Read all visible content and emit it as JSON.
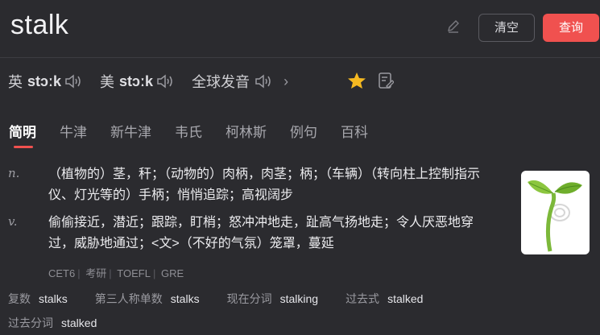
{
  "query": {
    "word": "stalk",
    "clear_label": "清空",
    "search_label": "查询"
  },
  "pronunciation": [
    {
      "lang": "英",
      "ipa": "stɔːk"
    },
    {
      "lang": "美",
      "ipa": "stɔːk"
    },
    {
      "lang": "全球发音",
      "ipa": ""
    }
  ],
  "tabs": [
    "简明",
    "牛津",
    "新牛津",
    "韦氏",
    "柯林斯",
    "例句",
    "百科"
  ],
  "definitions": [
    {
      "pos": "n.",
      "text": "（植物的）茎，秆；（动物的）肉柄，肉茎；柄；（车辆）（转向柱上控制指示仪、灯光等的）手柄；悄悄追踪；高视阔步"
    },
    {
      "pos": "v.",
      "text": "偷偷接近，潜近；跟踪，盯梢；怒冲冲地走，趾高气扬地走；令人厌恶地穿过，威胁地通过；<文>（不好的气氛）笼罩，蔓延"
    }
  ],
  "tags": [
    "CET6",
    "考研",
    "TOEFL",
    "GRE"
  ],
  "forms": [
    {
      "label": "复数",
      "value": "stalks"
    },
    {
      "label": "第三人称单数",
      "value": "stalks"
    },
    {
      "label": "现在分词",
      "value": "stalking"
    },
    {
      "label": "过去式",
      "value": "stalked"
    },
    {
      "label": "过去分词",
      "value": "stalked"
    }
  ],
  "colors": {
    "accent": "#f0514f",
    "star": "#f5b921",
    "background": "#2b2b2f"
  }
}
